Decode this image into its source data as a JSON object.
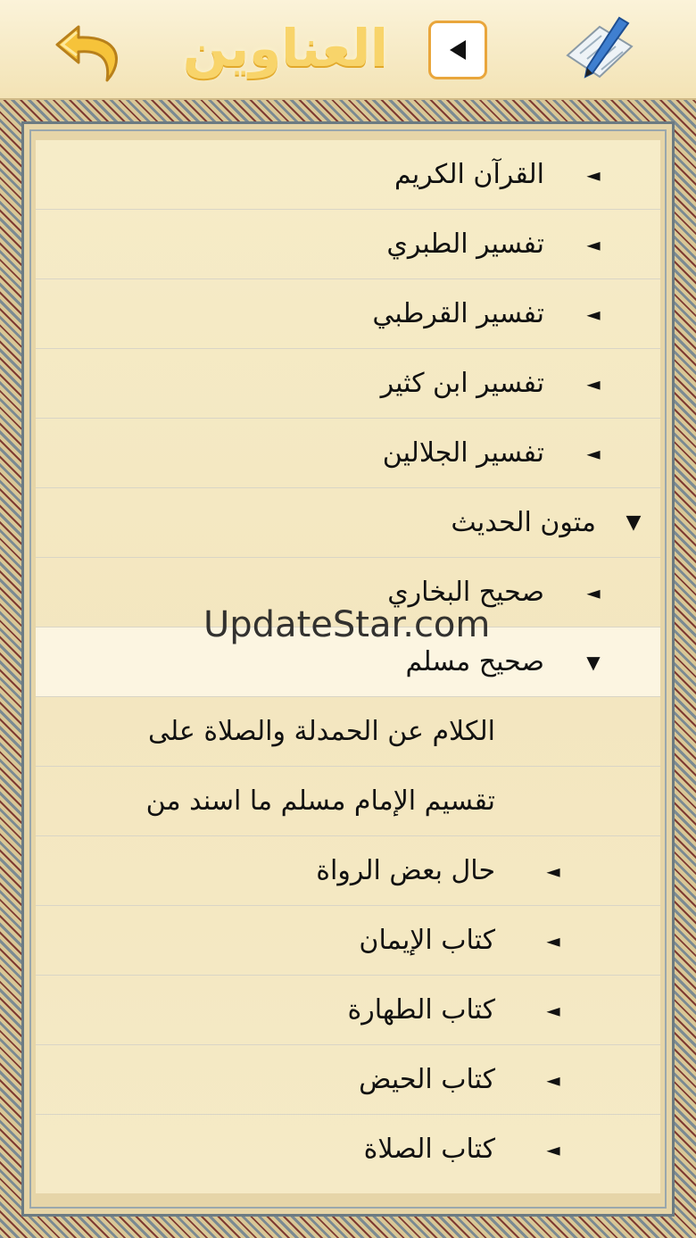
{
  "header": {
    "title": "العناوين",
    "back_icon": "curved-back-arrow-icon",
    "play_icon": "play-left-icon",
    "edit_icon": "pen-paper-icon",
    "title_color": "#f8d46a"
  },
  "tree": {
    "items": [
      {
        "label": "القرآن الكريم",
        "arrow": "◄"
      },
      {
        "label": "تفسير الطبري",
        "arrow": "◄"
      },
      {
        "label": "تفسير القرطبي",
        "arrow": "◄"
      },
      {
        "label": "تفسير ابن كثير",
        "arrow": "◄"
      },
      {
        "label": "تفسير الجلالين",
        "arrow": "◄"
      },
      {
        "label": "متون الحديث",
        "arrow": "▼"
      },
      {
        "label": "صحيح البخاري",
        "arrow": "◄"
      },
      {
        "label": "صحيح مسلم",
        "arrow": "▼"
      },
      {
        "label": "الكلام عن الحمدلة والصلاة على"
      },
      {
        "label": "تقسيم الإمام مسلم ما اسند من"
      },
      {
        "label": "حال بعض الرواة",
        "arrow": "◄"
      },
      {
        "label": "كتاب الإيمان",
        "arrow": "◄"
      },
      {
        "label": "كتاب الطهارة",
        "arrow": "◄"
      },
      {
        "label": "كتاب الحيض",
        "arrow": "◄"
      },
      {
        "label": "كتاب الصلاة",
        "arrow": "◄"
      }
    ]
  },
  "watermark": "UpdateStar.com"
}
